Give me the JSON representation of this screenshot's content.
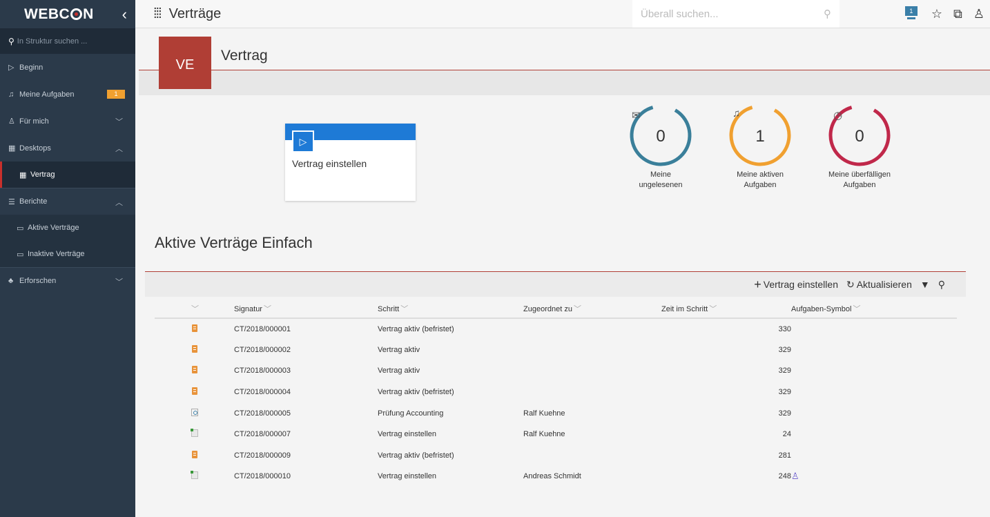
{
  "brand": {
    "logo_pre": "WEBC",
    "logo_post": "N"
  },
  "sidebar": {
    "search_placeholder": "In Struktur suchen ...",
    "items": [
      {
        "label": "Beginn",
        "icon": "play-outline-icon"
      },
      {
        "label": "Meine Aufgaben",
        "icon": "bell-icon",
        "badge": "1"
      },
      {
        "label": "Für mich",
        "icon": "person-icon"
      },
      {
        "label": "Desktops",
        "icon": "desktop-icon"
      },
      {
        "label": "Vertrag",
        "icon": "desktop-icon",
        "active": true
      },
      {
        "label": "Berichte",
        "icon": "report-icon"
      },
      {
        "label": "Aktive Verträge",
        "icon": "report-list-icon"
      },
      {
        "label": "Inaktive Verträge",
        "icon": "report-list-icon"
      },
      {
        "label": "Erforschen",
        "icon": "explore-icon"
      }
    ]
  },
  "topbar": {
    "title": "Verträge",
    "search_placeholder": "Überall suchen...",
    "notification_count": "1"
  },
  "header": {
    "initials": "VE",
    "title": "Vertrag"
  },
  "start_tile": {
    "label": "Vertrag einstellen"
  },
  "counters": [
    {
      "value": "0",
      "line1": "Meine",
      "line2": "ungelesenen",
      "color": "#3a7f9a",
      "icon": "envelope-icon"
    },
    {
      "value": "1",
      "line1": "Meine aktiven",
      "line2": "Aufgaben",
      "color": "#f0a030",
      "icon": "bell-icon"
    },
    {
      "value": "0",
      "line1": "Meine überfälligen",
      "line2": "Aufgaben",
      "color": "#c0284a",
      "icon": "clock-icon"
    }
  ],
  "report": {
    "title": "Aktive Verträge Einfach",
    "toolbar": {
      "add": "Vertrag einstellen",
      "refresh": "Aktualisieren"
    },
    "columns": [
      "Signatur",
      "Schritt",
      "Zugeordnet zu",
      "Zeit im Schritt",
      "Aufgaben-Symbol"
    ],
    "rows": [
      {
        "icon": "doc",
        "sig": "CT/2018/000001",
        "step": "Vertrag aktiv (befristet)",
        "assigned": "",
        "time": "330",
        "task": ""
      },
      {
        "icon": "doc",
        "sig": "CT/2018/000002",
        "step": "Vertrag aktiv",
        "assigned": "",
        "time": "329",
        "task": ""
      },
      {
        "icon": "doc",
        "sig": "CT/2018/000003",
        "step": "Vertrag aktiv",
        "assigned": "",
        "time": "329",
        "task": ""
      },
      {
        "icon": "doc",
        "sig": "CT/2018/000004",
        "step": "Vertrag aktiv (befristet)",
        "assigned": "",
        "time": "329",
        "task": ""
      },
      {
        "icon": "rev",
        "sig": "CT/2018/000005",
        "step": "Prüfung Accounting",
        "assigned": "Ralf Kuehne",
        "time": "329",
        "task": ""
      },
      {
        "icon": "add",
        "sig": "CT/2018/000007",
        "step": "Vertrag einstellen",
        "assigned": "Ralf Kuehne",
        "time": "24",
        "task": ""
      },
      {
        "icon": "doc",
        "sig": "CT/2018/000009",
        "step": "Vertrag aktiv (befristet)",
        "assigned": "",
        "time": "281",
        "task": ""
      },
      {
        "icon": "add",
        "sig": "CT/2018/000010",
        "step": "Vertrag einstellen",
        "assigned": "Andreas Schmidt",
        "time": "248",
        "task": "person"
      }
    ]
  }
}
